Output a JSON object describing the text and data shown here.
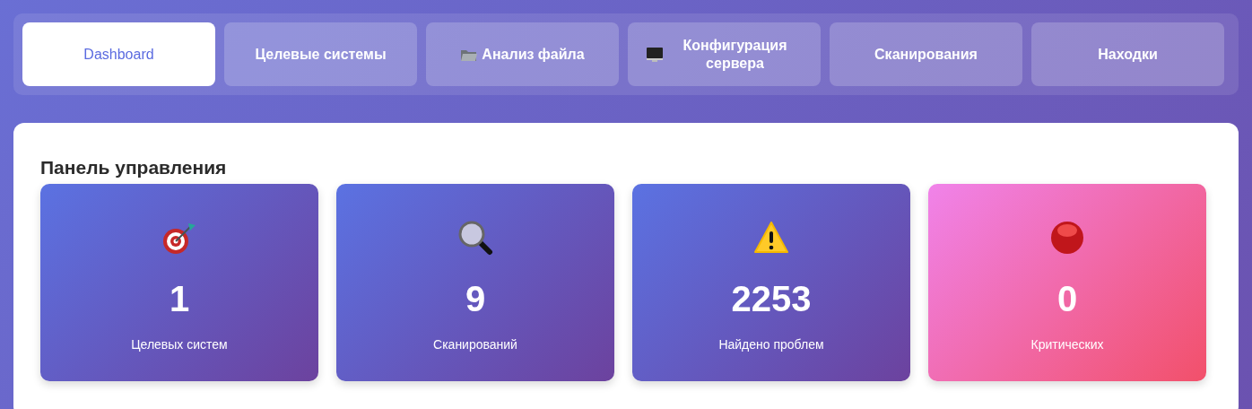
{
  "tabs": [
    {
      "label": "Dashboard",
      "selected": true
    },
    {
      "label": "Целевые системы",
      "selected": false
    },
    {
      "label": "Анализ файла",
      "selected": false
    },
    {
      "label": "Конфигурация сервера",
      "selected": false
    },
    {
      "label": "Сканирования",
      "selected": false
    },
    {
      "label": "Находки",
      "selected": false
    }
  ],
  "panel": {
    "title": "Панель управления",
    "cards": [
      {
        "value": "1",
        "label": "Целевых систем",
        "kind": "normal"
      },
      {
        "value": "9",
        "label": "Сканирований",
        "kind": "normal"
      },
      {
        "value": "2253",
        "label": "Найдено проблем",
        "kind": "normal"
      },
      {
        "value": "0",
        "label": "Критических",
        "kind": "critical"
      }
    ]
  }
}
